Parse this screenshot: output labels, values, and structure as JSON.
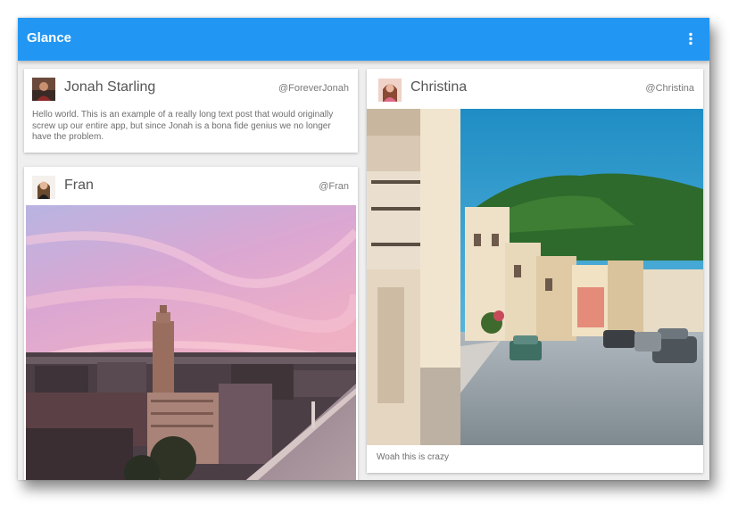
{
  "app": {
    "title": "Glance",
    "menu_icon": "more-vert-icon"
  },
  "colors": {
    "app_bar": "#2196f3",
    "background": "#efefef",
    "card": "#ffffff"
  },
  "posts": [
    {
      "name": "Jonah Starling",
      "handle": "@ForeverJonah",
      "text": "Hello world. This is an example of a really long text post that would originally screw up our entire app, but since Jonah is a bona fide genius we no longer have the problem."
    },
    {
      "name": "Fran",
      "handle": "@Fran",
      "image": "city-skyline-at-sunset-photo"
    },
    {
      "name": "Christina",
      "handle": "@Christina",
      "image": "village-street-with-hills-photo",
      "caption": "Woah this is crazy"
    }
  ]
}
